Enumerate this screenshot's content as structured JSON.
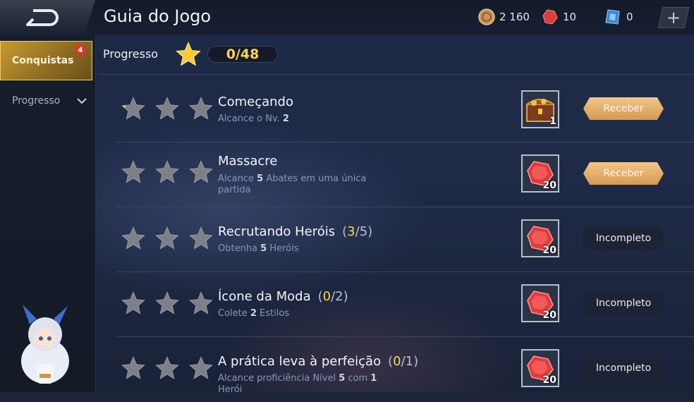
{
  "header": {
    "title": "Guia do Jogo",
    "coins": "2 160",
    "gems": "10",
    "tickets": "0",
    "add_label": "+"
  },
  "sidebar": {
    "active_tab": "Conquistas",
    "active_badge": "4",
    "secondary_tab": "Progresso"
  },
  "progress": {
    "label": "Progresso",
    "value": "0/48",
    "stars_earned": 0,
    "stars_total": 48
  },
  "achievements": [
    {
      "title": "Começando",
      "count_done": "",
      "count_total": "",
      "desc_pre": "Alcance o Nv. ",
      "desc_num": "2",
      "desc_post": "",
      "desc_num2": "",
      "desc_post2": "",
      "reward_icon": "treasure-chest-icon",
      "reward_qty": "1",
      "button": "Receber",
      "button_state": "claim",
      "stars_filled": 0.15
    },
    {
      "title": "Massacre",
      "count_done": "",
      "count_total": "",
      "desc_pre": "Alcance ",
      "desc_num": "5",
      "desc_post": " Abates em uma única partida",
      "desc_num2": "",
      "desc_post2": "",
      "reward_icon": "red-gem-icon",
      "reward_qty": "20",
      "button": "Receber",
      "button_state": "claim",
      "stars_filled": 0
    },
    {
      "title": "Recrutando Heróis",
      "count_done": "3",
      "count_total": "5",
      "desc_pre": "Obtenha ",
      "desc_num": "5",
      "desc_post": " Heróis",
      "desc_num2": "",
      "desc_post2": "",
      "reward_icon": "red-gem-icon",
      "reward_qty": "20",
      "button": "Incompleto",
      "button_state": "incomplete",
      "stars_filled": 0
    },
    {
      "title": "Ícone da Moda",
      "count_done": "0",
      "count_total": "2",
      "desc_pre": "Colete ",
      "desc_num": "2",
      "desc_post": " Estilos",
      "desc_num2": "",
      "desc_post2": "",
      "reward_icon": "red-gem-icon",
      "reward_qty": "20",
      "button": "Incompleto",
      "button_state": "incomplete",
      "stars_filled": 0
    },
    {
      "title": "A prática leva à perfeição",
      "count_done": "0",
      "count_total": "1",
      "desc_pre": "Alcance proficiência Nível ",
      "desc_num": "5",
      "desc_post": " com ",
      "desc_num2": "1",
      "desc_post2": " Herói",
      "reward_icon": "red-gem-icon",
      "reward_qty": "20",
      "button": "Incompleto",
      "button_state": "incomplete",
      "stars_filled": 0
    }
  ],
  "colors": {
    "gold": "#ffd54a",
    "claim_button": "#e3ad66",
    "gem_red": "#e23b3b"
  }
}
